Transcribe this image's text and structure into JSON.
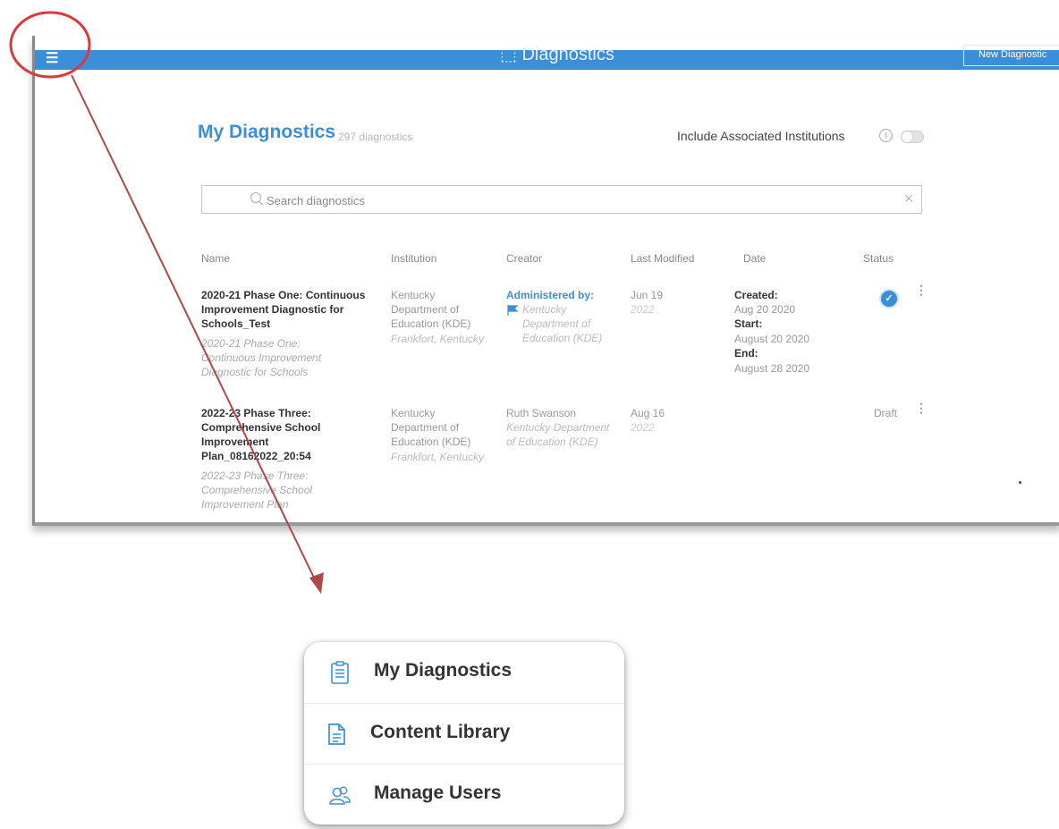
{
  "app": {
    "title": "Diagnostics",
    "new_button": "New Diagnostic"
  },
  "page": {
    "title": "My Diagnostics",
    "count": "297 diagnostics",
    "include_label": "Include Associated Institutions",
    "search_placeholder": "Search diagnostics"
  },
  "table": {
    "headers": [
      "Name",
      "Institution",
      "Creator",
      "Last Modified",
      "Date",
      "Status"
    ],
    "rows": [
      {
        "name": "2020-21 Phase One: Continuous Improvement Diagnostic for Schools_Test",
        "subtitle": "2020-21 Phase One: Continuous Improvement Diagnostic for Schools",
        "institution": "Kentucky Department of Education (KDE)",
        "location": "Frankfort, Kentucky",
        "creator_label": "Administered by:",
        "creator_org": "Kentucky Department of Education (KDE)",
        "modified": "Jun 19",
        "modified_year": "2022",
        "created_label": "Created:",
        "created": "Aug 20 2020",
        "start_label": "Start:",
        "start": "August 20 2020",
        "end_label": "End:",
        "end": "August 28 2020",
        "status": "check"
      },
      {
        "name": "2022-23 Phase Three: Comprehensive School Improvement Plan_08162022_20:54",
        "subtitle": "2022-23 Phase Three: Comprehensive School Improvement Plan",
        "institution": "Kentucky Department of Education (KDE)",
        "location": "Frankfort, Kentucky",
        "creator": "Ruth Swanson",
        "creator_org": "Kentucky Department of Education (KDE)",
        "modified": "Aug 16",
        "modified_year": "2022",
        "status": "Draft"
      }
    ]
  },
  "nav_menu": {
    "items": [
      {
        "label": "My Diagnostics",
        "icon": "clipboard-icon"
      },
      {
        "label": "Content Library",
        "icon": "document-icon"
      },
      {
        "label": "Manage Users",
        "icon": "users-icon"
      }
    ]
  },
  "colors": {
    "accent": "#3b8fd8",
    "annotation_circle": "#d93a3a",
    "annotation_arrow": "#b04848"
  }
}
